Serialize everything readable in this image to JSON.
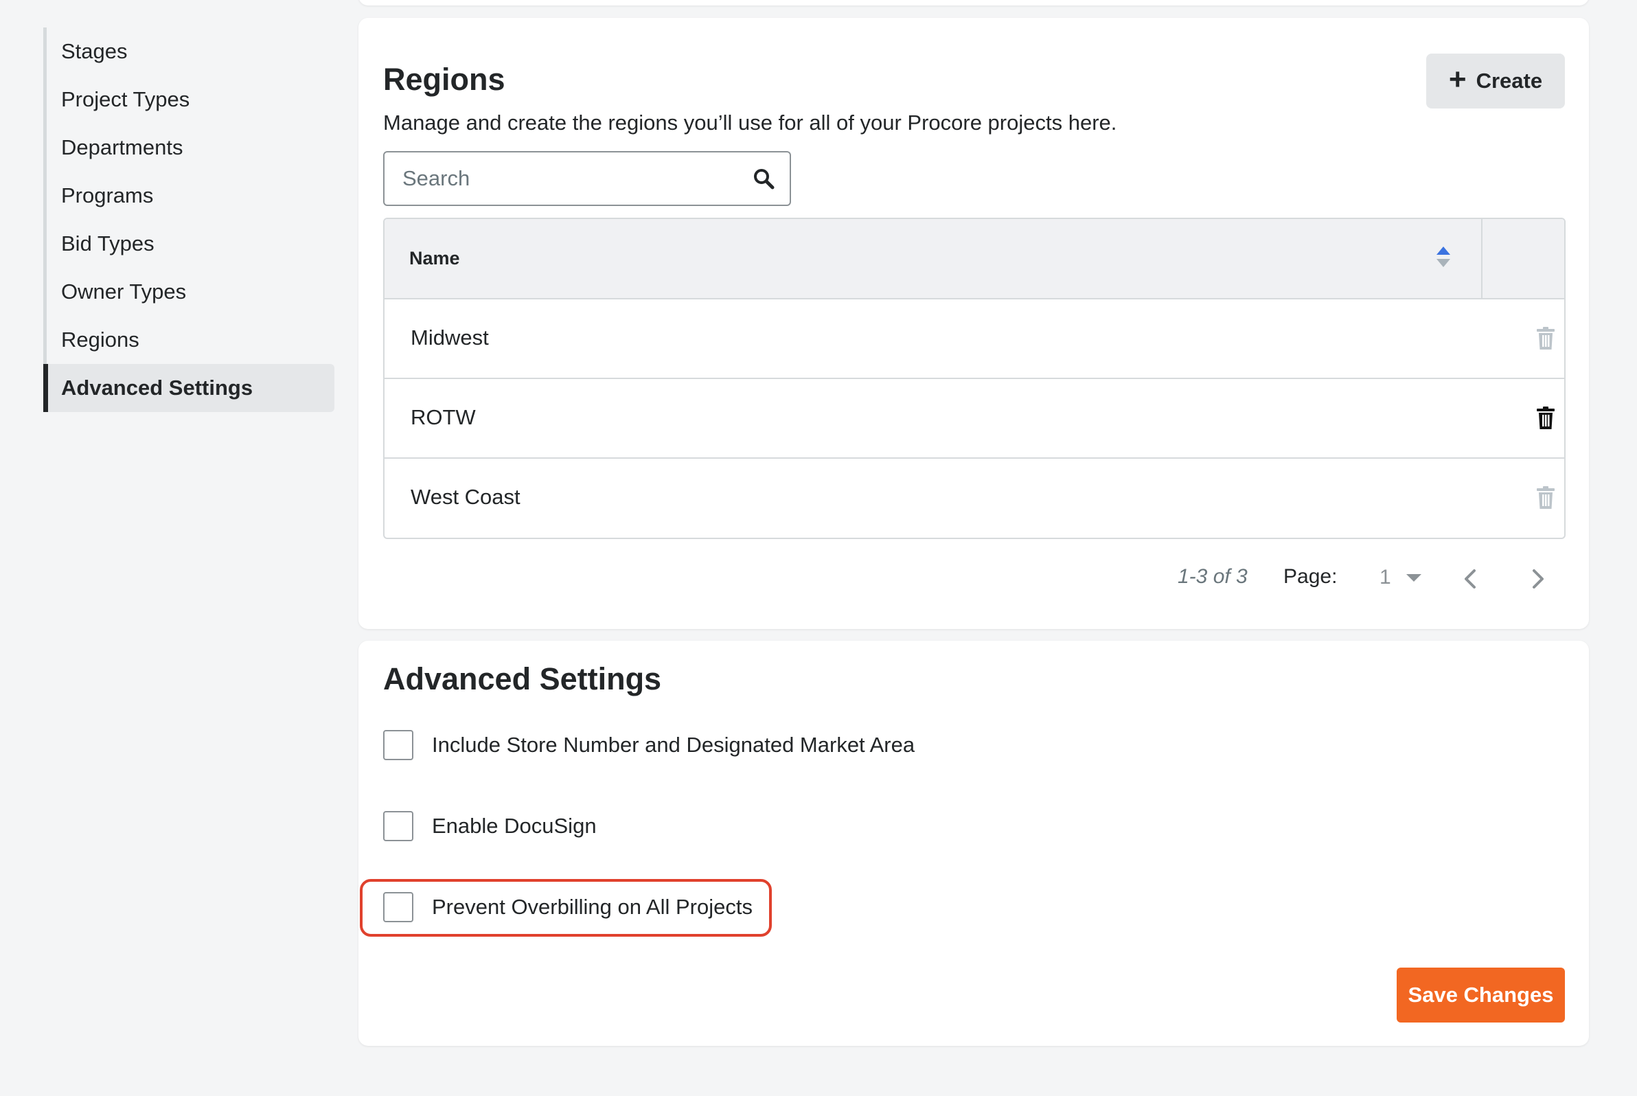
{
  "sidebar": {
    "items": [
      {
        "label": "Stages"
      },
      {
        "label": "Project Types"
      },
      {
        "label": "Departments"
      },
      {
        "label": "Programs"
      },
      {
        "label": "Bid Types"
      },
      {
        "label": "Owner Types"
      },
      {
        "label": "Regions"
      },
      {
        "label": "Advanced Settings",
        "active": true
      }
    ]
  },
  "regions": {
    "title": "Regions",
    "description": "Manage and create the regions you’ll use for all of your Procore projects here.",
    "create_label": "Create",
    "search": {
      "placeholder": "Search",
      "value": ""
    },
    "table": {
      "column_name": "Name",
      "rows": [
        {
          "name": "Midwest",
          "trash_state": "muted"
        },
        {
          "name": "ROTW",
          "trash_state": "hover"
        },
        {
          "name": "West Coast",
          "trash_state": "muted"
        }
      ]
    },
    "pagination": {
      "range": "1-3 of 3",
      "page_label": "Page:",
      "current_page": "1"
    }
  },
  "advanced": {
    "title": "Advanced Settings",
    "options": [
      {
        "label": "Include Store Number and Designated Market Area",
        "checked": false
      },
      {
        "label": "Enable DocuSign",
        "checked": false
      },
      {
        "label": "Prevent Overbilling on All Projects",
        "checked": false,
        "highlighted": true
      }
    ],
    "save_label": "Save Changes"
  },
  "colors": {
    "accent_orange": "#f26722",
    "highlight_red": "#e0412d",
    "sort_blue": "#3b73e0",
    "text": "#232628"
  },
  "icons": {
    "search": "search-icon",
    "plus": "plus-icon",
    "trash": "trash-icon",
    "sort": "sort-icon",
    "caret": "caret-down-icon",
    "prev": "chevron-left-icon",
    "next": "chevron-right-icon"
  }
}
